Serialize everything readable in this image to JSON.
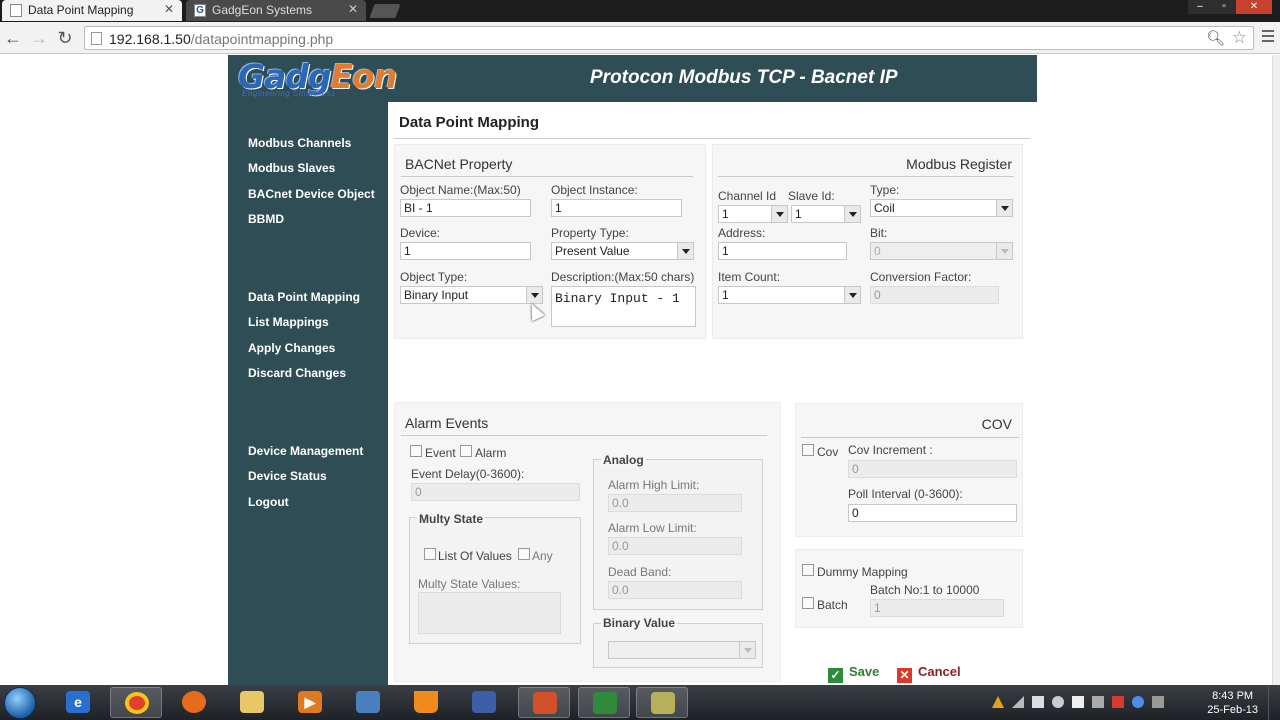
{
  "browser": {
    "tabs": [
      {
        "title": "Data Point Mapping",
        "active": true
      },
      {
        "title": "GadgEon Systems",
        "active": false
      }
    ],
    "url_host": "192.168.1.50",
    "url_path": "/datapointmapping.php",
    "favicon_letter": "G"
  },
  "app": {
    "logo_part1": "Gadg",
    "logo_part2": "Eon",
    "tagline": "Engineering Smartness",
    "title": "Protocon Modbus TCP - Bacnet IP"
  },
  "sidebar": {
    "items": [
      "Modbus Channels",
      "Modbus Slaves",
      "BACnet Device Object",
      "BBMD",
      "Data Point Mapping",
      "List Mappings",
      "Apply Changes",
      "Discard Changes",
      "Device Management",
      "Device Status",
      "Logout"
    ]
  },
  "page": {
    "title": "Data Point Mapping"
  },
  "bacnet": {
    "title": "BACNet Property",
    "object_name_label": "Object Name:(Max:50)",
    "object_name": "BI - 1",
    "object_instance_label": "Object Instance:",
    "object_instance": "1",
    "device_label": "Device:",
    "device": "1",
    "property_type_label": "Property Type:",
    "property_type": "Present Value",
    "object_type_label": "Object Type:",
    "object_type": "Binary Input",
    "description_label": "Description:(Max:50 chars)",
    "description": "Binary Input - 1"
  },
  "modbus": {
    "title": "Modbus Register",
    "channel_label": "Channel Id",
    "channel": "1",
    "slave_label": "Slave Id:",
    "slave": "1",
    "type_label": "Type:",
    "type": "Coil",
    "address_label": "Address:",
    "address": "1",
    "bit_label": "Bit:",
    "bit": "0",
    "item_count_label": "Item Count:",
    "item_count": "1",
    "conversion_label": "Conversion Factor:",
    "conversion": "0"
  },
  "alarm": {
    "title": "Alarm Events",
    "event_label": "Event",
    "alarm_label": "Alarm",
    "event_delay_label": "Event Delay(0-3600):",
    "event_delay": "0",
    "multi_state_legend": "Multy State",
    "list_of_values_label": "List Of Values",
    "any_label": "Any",
    "multi_state_values_label": "Multy State Values:",
    "analog_legend": "Analog",
    "alarm_high_label": "Alarm High Limit:",
    "alarm_high": "0.0",
    "alarm_low_label": "Alarm Low Limit:",
    "alarm_low": "0.0",
    "dead_band_label": "Dead Band:",
    "dead_band": "0.0",
    "binary_value_legend": "Binary Value",
    "binary_value": ""
  },
  "cov": {
    "title": "COV",
    "cov_label": "Cov",
    "increment_label": "Cov Increment :",
    "increment": "0",
    "poll_label": "Poll Interval (0-3600):",
    "poll": "0"
  },
  "dummy": {
    "dummy_label": "Dummy Mapping",
    "batch_label": "Batch",
    "batch_range_label": "Batch No:1 to 10000",
    "batch": "1"
  },
  "actions": {
    "save": "Save",
    "cancel": "Cancel"
  },
  "taskbar": {
    "time": "8:43 PM",
    "date": "25-Feb-13"
  },
  "colors": {
    "header_bg": "#2f4d55",
    "logo_blue": "#2b67b8",
    "logo_orange": "#e47a2a",
    "save_green": "#2e8b3a",
    "cancel_red": "#d93a2c"
  }
}
